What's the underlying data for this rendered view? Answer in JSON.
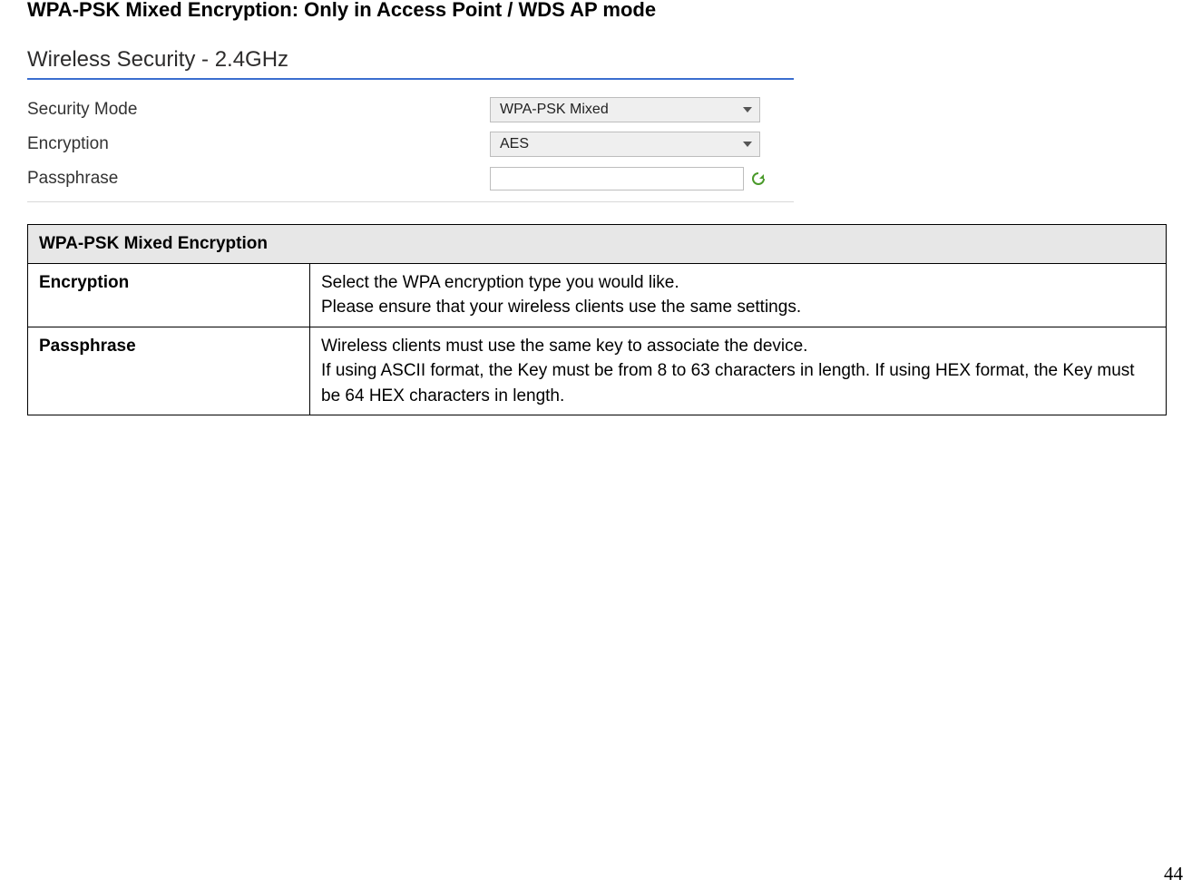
{
  "title": "WPA-PSK Mixed Encryption: Only in Access Point / WDS AP mode",
  "panel": {
    "heading": "Wireless Security - 2.4GHz",
    "rows": {
      "security_mode_label": "Security Mode",
      "security_mode_value": "WPA-PSK Mixed",
      "encryption_label": "Encryption",
      "encryption_value": "AES",
      "passphrase_label": "Passphrase",
      "passphrase_value": ""
    }
  },
  "table": {
    "header": "WPA-PSK Mixed Encryption",
    "rows": [
      {
        "term": "Encryption",
        "desc_line1": "Select the WPA encryption type you would like.",
        "desc_line2": "Please ensure that your wireless clients use the same settings."
      },
      {
        "term": "Passphrase",
        "desc_line1": "Wireless clients must use the same key to associate the device.",
        "desc_line2": "If using ASCII format, the Key must be from 8 to 63 characters in length. If using HEX format, the Key must be 64 HEX characters in length."
      }
    ]
  },
  "page_number": "44"
}
